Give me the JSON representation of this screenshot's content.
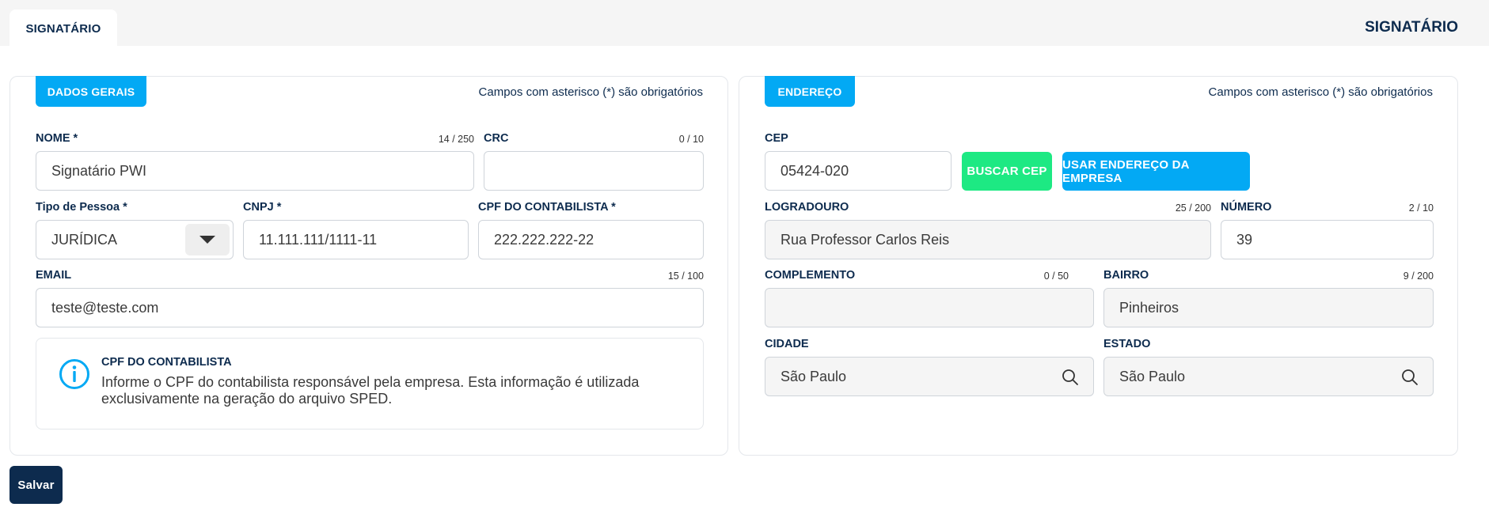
{
  "tab": {
    "label": "SIGNATÁRIO"
  },
  "page_title": "SIGNATÁRIO",
  "required_note": "Campos com asterisco (*) são obrigatórios",
  "left": {
    "section": "DADOS GERAIS",
    "nome": {
      "label": "NOME *",
      "counter": "14 / 250",
      "value": "Signatário PWI"
    },
    "crc": {
      "label": "CRC",
      "counter": "0 / 10",
      "value": ""
    },
    "tipo_pessoa": {
      "label": "Tipo de Pessoa *",
      "value": "JURÍDICA"
    },
    "cnpj": {
      "label": "CNPJ *",
      "value": "11.111.111/1111-11"
    },
    "cpf_contabilista": {
      "label": "CPF DO CONTABILISTA *",
      "value": "222.222.222-22"
    },
    "email": {
      "label": "EMAIL",
      "counter": "15 / 100",
      "value": "teste@teste.com"
    },
    "info": {
      "icon": "info-circle-icon",
      "title": "CPF DO CONTABILISTA",
      "text": "Informe o CPF do contabilista responsável pela empresa. Esta informação é utilizada exclusivamente na geração do arquivo SPED."
    }
  },
  "right": {
    "section": "ENDEREÇO",
    "cep": {
      "label": "CEP",
      "value": "05424-020"
    },
    "buscar_cep": "BUSCAR CEP",
    "usar_endereco": "USAR ENDEREÇO DA EMPRESA",
    "logradouro": {
      "label": "LOGRADOURO",
      "counter": "25 / 200",
      "value": "Rua Professor Carlos Reis"
    },
    "numero": {
      "label": "NÚMERO",
      "counter": "2 / 10",
      "value": "39"
    },
    "complemento": {
      "label": "COMPLEMENTO",
      "counter": "0 / 50",
      "value": ""
    },
    "bairro": {
      "label": "BAIRRO",
      "counter": "9 / 200",
      "value": "Pinheiros"
    },
    "cidade": {
      "label": "CIDADE",
      "value": "São Paulo"
    },
    "estado": {
      "label": "ESTADO",
      "value": "São Paulo"
    }
  },
  "save_label": "Salvar",
  "colors": {
    "primary": "#03a9f4",
    "navy": "#0d2b4e",
    "green": "#1de983"
  }
}
